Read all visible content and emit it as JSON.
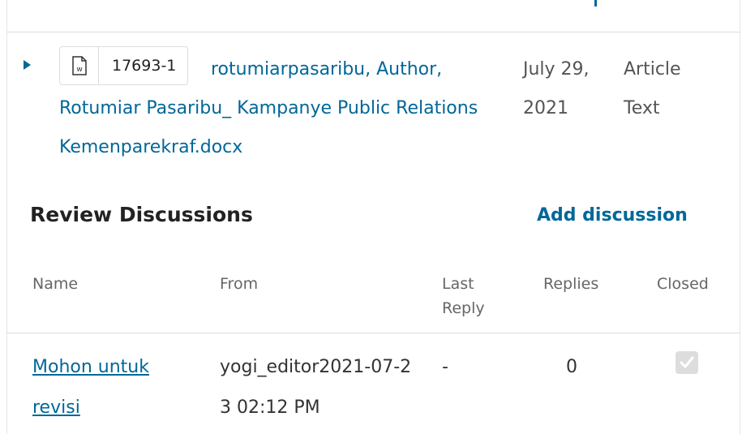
{
  "file": {
    "id": "17693-1",
    "name": "rotumiarpasaribu, Author, Rotumiar Pasaribu_ Kampanye Public Relations Kemenparekraf.docx",
    "date": "July 29, 2021",
    "type": "Article Text",
    "icon": "word-document-icon"
  },
  "review_discussions": {
    "title": "Review Discussions",
    "add_label": "Add discussion",
    "columns": {
      "name": "Name",
      "from": "From",
      "last_reply": "Last Reply",
      "replies": "Replies",
      "closed": "Closed"
    },
    "rows": [
      {
        "name": "Mohon untuk revisi",
        "from": "yogi_editor2021-07-23 02:12 PM",
        "last_reply": "-",
        "replies": "0",
        "closed": true
      }
    ]
  },
  "colors": {
    "link": "#006798",
    "border": "#dddddd"
  }
}
